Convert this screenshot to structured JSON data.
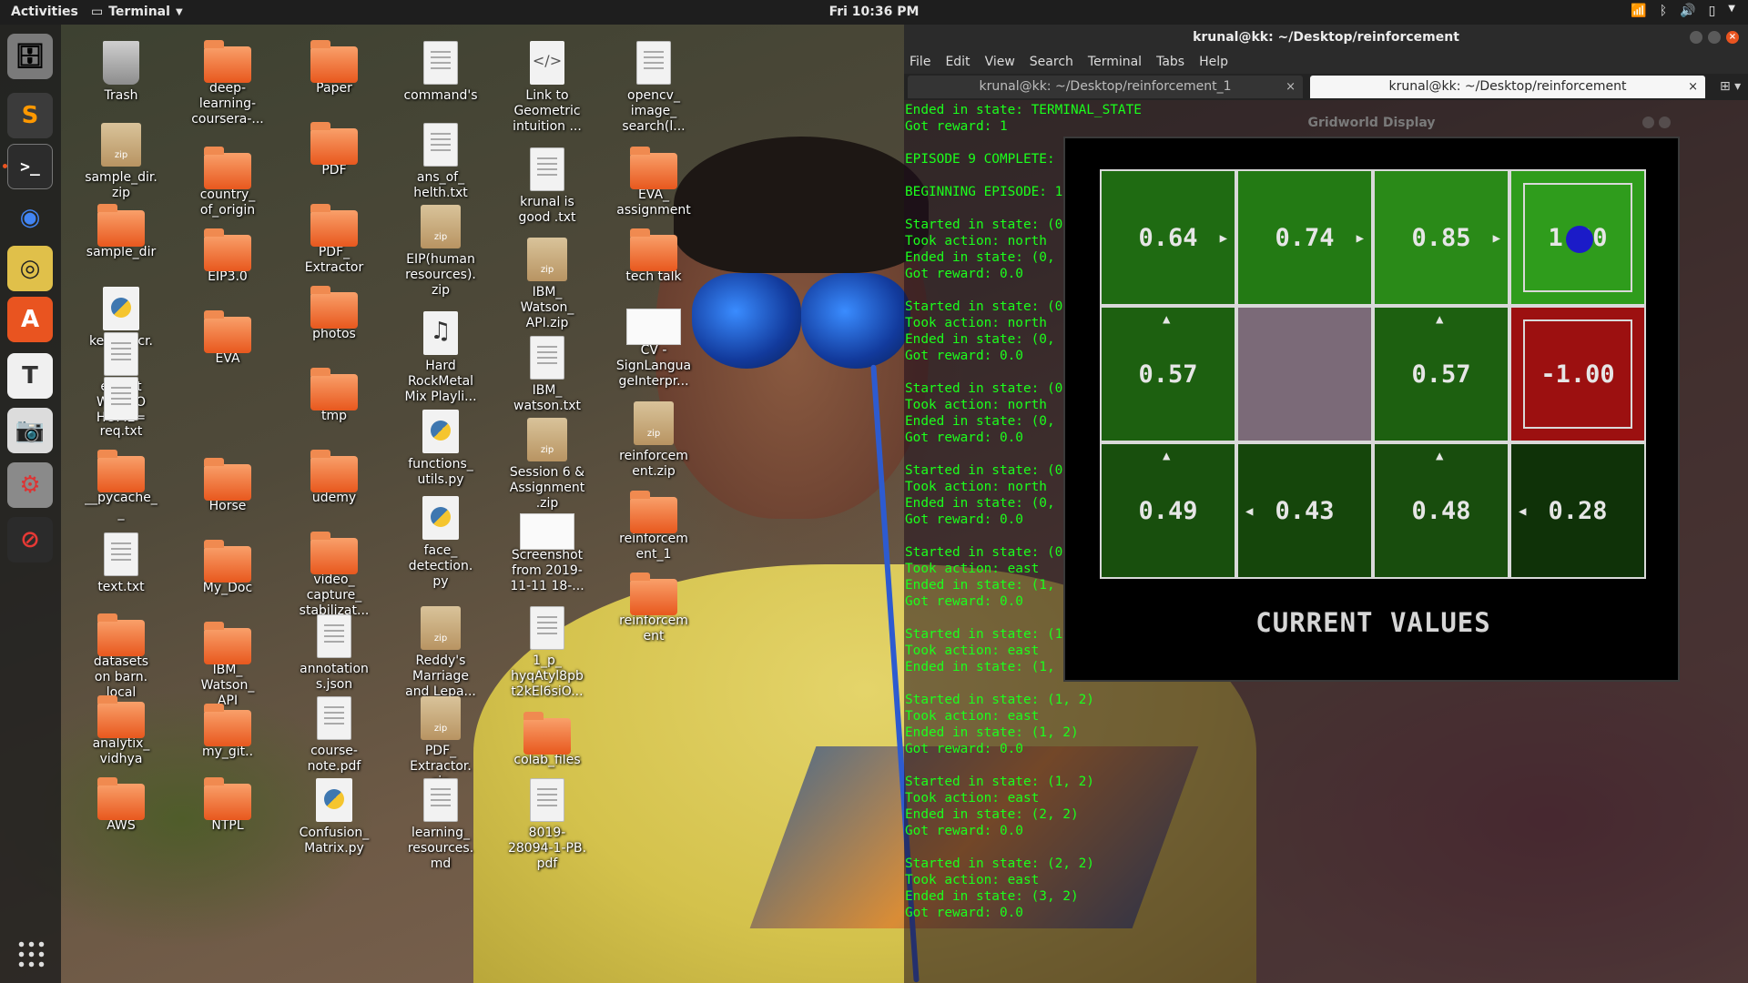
{
  "topbar": {
    "activities": "Activities",
    "app_name": "Terminal",
    "clock": "Fri 10:36 PM"
  },
  "dock": [
    {
      "name": "files-icon",
      "glyph": "🗄",
      "bg": "#7a7a7a"
    },
    {
      "name": "sublime-text-icon",
      "glyph": "S",
      "bg": "#3b3b3b",
      "color": "#ff9800"
    },
    {
      "name": "terminal-icon",
      "glyph": ">_",
      "bg": "#2c2c2c",
      "color": "#ffffff"
    },
    {
      "name": "chrome-icon",
      "glyph": "◉",
      "bg": "transparent",
      "color": "#4285f4"
    },
    {
      "name": "rhythmbox-icon",
      "glyph": "◎",
      "bg": "#e0c04a",
      "color": "#222"
    },
    {
      "name": "software-center-icon",
      "glyph": "A",
      "bg": "#e95420",
      "color": "#ffffff"
    },
    {
      "name": "text-editor-icon",
      "glyph": "T",
      "bg": "#f0f0f0",
      "color": "#333"
    },
    {
      "name": "screenshot-icon",
      "glyph": "📷",
      "bg": "#dcdcdc",
      "color": "#333"
    },
    {
      "name": "settings-icon",
      "glyph": "⚙",
      "bg": "#8a8a8a",
      "color": "#d33"
    },
    {
      "name": "blocked-app-icon",
      "glyph": "⊘",
      "bg": "#2b2b2b",
      "color": "#e53935"
    }
  ],
  "desktop_icons": [
    {
      "label": "Trash",
      "type": "trash",
      "col": 0,
      "row": 0
    },
    {
      "label": "sample_dir.\nzip",
      "type": "zip",
      "col": 0,
      "row": 1
    },
    {
      "label": "sample_dir",
      "type": "folder",
      "col": 0,
      "row": 2
    },
    {
      "label": "keras_ocr.\npy",
      "type": "py",
      "col": 0,
      "row": 3
    },
    {
      "label": "export\nWORKO\nHOME=",
      "type": "doc",
      "col": 0,
      "row": 3.55
    },
    {
      "label": "req.txt",
      "type": "doc",
      "col": 0,
      "row": 4.1
    },
    {
      "label": "__pycache_\n_",
      "type": "folder",
      "col": 0,
      "row": 5
    },
    {
      "label": "text.txt",
      "type": "doc",
      "col": 0,
      "row": 6
    },
    {
      "label": "datasets\non barn.\nlocal",
      "type": "folder",
      "col": 0,
      "row": 7
    },
    {
      "label": "analytix_\nvidhya",
      "type": "folder",
      "col": 0,
      "row": 8
    },
    {
      "label": "AWS",
      "type": "folder",
      "col": 0,
      "row": 9
    },
    {
      "label": "deep-\nlearning-\ncoursera-...",
      "type": "folder",
      "col": 1,
      "row": 0
    },
    {
      "label": "country_\nof_origin",
      "type": "folder",
      "col": 1,
      "row": 1.3
    },
    {
      "label": "EIP3.0",
      "type": "folder",
      "col": 1,
      "row": 2.3
    },
    {
      "label": "EVA",
      "type": "folder",
      "col": 1,
      "row": 3.3
    },
    {
      "label": "Horse",
      "type": "folder",
      "col": 1,
      "row": 5.1
    },
    {
      "label": "My_Doc",
      "type": "folder",
      "col": 1,
      "row": 6.1
    },
    {
      "label": "IBM_\nWatson_\nAPI",
      "type": "folder",
      "col": 1,
      "row": 7.1
    },
    {
      "label": "my_git..",
      "type": "folder",
      "col": 1,
      "row": 8.1
    },
    {
      "label": "NTPL",
      "type": "folder",
      "col": 1,
      "row": 9
    },
    {
      "label": "Paper",
      "type": "folder",
      "col": 2,
      "row": 0
    },
    {
      "label": "PDF",
      "type": "folder",
      "col": 2,
      "row": 1
    },
    {
      "label": "PDF_\nExtractor",
      "type": "folder",
      "col": 2,
      "row": 2
    },
    {
      "label": "photos",
      "type": "folder",
      "col": 2,
      "row": 3
    },
    {
      "label": "tmp",
      "type": "folder",
      "col": 2,
      "row": 4
    },
    {
      "label": "udemy",
      "type": "folder",
      "col": 2,
      "row": 5
    },
    {
      "label": "video_\ncapture_\nstabilizat...",
      "type": "folder",
      "col": 2,
      "row": 6
    },
    {
      "label": "annotation\ns.json",
      "type": "doc",
      "col": 2,
      "row": 7
    },
    {
      "label": "course-\nnote.pdf",
      "type": "doc",
      "col": 2,
      "row": 8
    },
    {
      "label": "Confusion_\nMatrix.py",
      "type": "py",
      "col": 2,
      "row": 9
    },
    {
      "label": "command's",
      "type": "doc",
      "col": 3,
      "row": 0
    },
    {
      "label": "ans_of_\nhelth.txt",
      "type": "doc",
      "col": 3,
      "row": 1
    },
    {
      "label": "EIP(human\nresources).\nzip",
      "type": "zip",
      "col": 3,
      "row": 2
    },
    {
      "label": "Hard\nRockMetal\nMix Playli...",
      "type": "music",
      "col": 3,
      "row": 3.3
    },
    {
      "label": "functions_\nutils.py",
      "type": "py",
      "col": 3,
      "row": 4.5
    },
    {
      "label": "face_\ndetection.\npy",
      "type": "py",
      "col": 3,
      "row": 5.55
    },
    {
      "label": "Reddy's\nMarriage\nand Lepa...",
      "type": "zip",
      "col": 3,
      "row": 6.9
    },
    {
      "label": "PDF_\nExtractor.\nzip",
      "type": "zip",
      "col": 3,
      "row": 8
    },
    {
      "label": "learning_\nresources.\nmd",
      "type": "doc",
      "col": 3,
      "row": 9
    },
    {
      "label": "Link to\nGeometric\nintuition ...",
      "type": "link",
      "col": 4,
      "row": 0
    },
    {
      "label": "krunal is\ngood .txt",
      "type": "doc",
      "col": 4,
      "row": 1.3
    },
    {
      "label": "IBM_\nWatson_\nAPI.zip",
      "type": "zip",
      "col": 4,
      "row": 2.4
    },
    {
      "label": "IBM_\nwatson.txt",
      "type": "doc",
      "col": 4,
      "row": 3.6
    },
    {
      "label": "Session 6 &\nAssignment\n.zip",
      "type": "zip",
      "col": 4,
      "row": 4.6
    },
    {
      "label": "Screenshot\nfrom 2019-\n11-11 18-...",
      "type": "img",
      "col": 4,
      "row": 5.7
    },
    {
      "label": "1_p_\nhyqAtyl8pb\nt2kEl6siO...",
      "type": "doc",
      "col": 4,
      "row": 6.9
    },
    {
      "label": "colab_files",
      "type": "folder",
      "col": 4,
      "row": 8.2
    },
    {
      "label": "8019-\n28094-1-PB.\npdf",
      "type": "doc",
      "col": 4,
      "row": 9
    },
    {
      "label": "opencv_\nimage_\nsearch(l...",
      "type": "doc",
      "col": 5,
      "row": 0
    },
    {
      "label": "EVA_\nassignment",
      "type": "folder",
      "col": 5,
      "row": 1.3
    },
    {
      "label": "tech talk",
      "type": "folder",
      "col": 5,
      "row": 2.3
    },
    {
      "label": "CV -\nSignLangua\ngeInterpr...",
      "type": "img",
      "col": 5,
      "row": 3.2
    },
    {
      "label": "reinforcem\nent.zip",
      "type": "zip",
      "col": 5,
      "row": 4.4
    },
    {
      "label": "reinforcem\nent_1",
      "type": "folder",
      "col": 5,
      "row": 5.5
    },
    {
      "label": "reinforcem\nent",
      "type": "folder",
      "col": 5,
      "row": 6.5
    }
  ],
  "terminal": {
    "title": "krunal@kk: ~/Desktop/reinforcement",
    "menu": [
      "File",
      "Edit",
      "View",
      "Search",
      "Terminal",
      "Tabs",
      "Help"
    ],
    "tabs": [
      {
        "label": "krunal@kk: ~/Desktop/reinforcement_1",
        "active": false
      },
      {
        "label": "krunal@kk: ~/Desktop/reinforcement",
        "active": true
      }
    ],
    "lines": [
      "Ended in state: TERMINAL_STATE",
      "Got reward: 1",
      "",
      "EPISODE 9 COMPLETE: RETURN WAS 0.59049",
      "",
      "BEGINNING EPISODE: 10",
      "",
      "Started in state: (0, 0)",
      "Took action: north",
      "Ended in state: (0, 1)",
      "Got reward: 0.0",
      "",
      "Started in state: (0, 1)",
      "Took action: north",
      "Ended in state: (0, 1)",
      "Got reward: 0.0",
      "",
      "Started in state: (0, 1)",
      "Took action: north",
      "Ended in state: (0, 1)",
      "Got reward: 0.0",
      "",
      "Started in state: (0, 1)",
      "Took action: north",
      "Ended in state: (0, 2)",
      "Got reward: 0.0",
      "",
      "Started in state: (0, 2)",
      "Took action: east",
      "Ended in state: (1, 2)",
      "Got reward: 0.0",
      "",
      "Started in state: (1, 2)",
      "Took action: east",
      "Ended in state: (1, 2)",
      "",
      "Started in state: (1, 2)",
      "Took action: east",
      "Ended in state: (1, 2)",
      "Got reward: 0.0",
      "",
      "Started in state: (1, 2)",
      "Took action: east",
      "Ended in state: (2, 2)",
      "Got reward: 0.0",
      "",
      "Started in state: (2, 2)",
      "Took action: east",
      "Ended in state: (3, 2)",
      "Got reward: 0.0"
    ]
  },
  "gridworld": {
    "title": "Gridworld Display",
    "caption": "CURRENT VALUES",
    "cells": [
      {
        "row": 0,
        "col": 0,
        "value": "0.64",
        "color": "#1f6b12",
        "arrow": "east"
      },
      {
        "row": 0,
        "col": 1,
        "value": "0.74",
        "color": "#237a14",
        "arrow": "east"
      },
      {
        "row": 0,
        "col": 2,
        "value": "0.85",
        "color": "#2a8a18",
        "arrow": "east"
      },
      {
        "row": 0,
        "col": 3,
        "value": "1.00",
        "color": "#2f9c1c",
        "arrow": "",
        "terminal": true,
        "agent": true
      },
      {
        "row": 1,
        "col": 0,
        "value": "0.57",
        "color": "#1d6010",
        "arrow": "north"
      },
      {
        "row": 1,
        "col": 1,
        "value": "",
        "color": "#7b6a78",
        "arrow": "",
        "wall": true
      },
      {
        "row": 1,
        "col": 2,
        "value": "0.57",
        "color": "#1d6010",
        "arrow": "north"
      },
      {
        "row": 1,
        "col": 3,
        "value": "-1.00",
        "color": "#9c1010",
        "arrow": "",
        "terminal": true
      },
      {
        "row": 2,
        "col": 0,
        "value": "0.49",
        "color": "#184f0d",
        "arrow": "north"
      },
      {
        "row": 2,
        "col": 1,
        "value": "0.43",
        "color": "#15460b",
        "arrow": "west"
      },
      {
        "row": 2,
        "col": 2,
        "value": "0.48",
        "color": "#184d0d",
        "arrow": "north"
      },
      {
        "row": 2,
        "col": 3,
        "value": "0.28",
        "color": "#0f3208",
        "arrow": "west"
      }
    ]
  }
}
